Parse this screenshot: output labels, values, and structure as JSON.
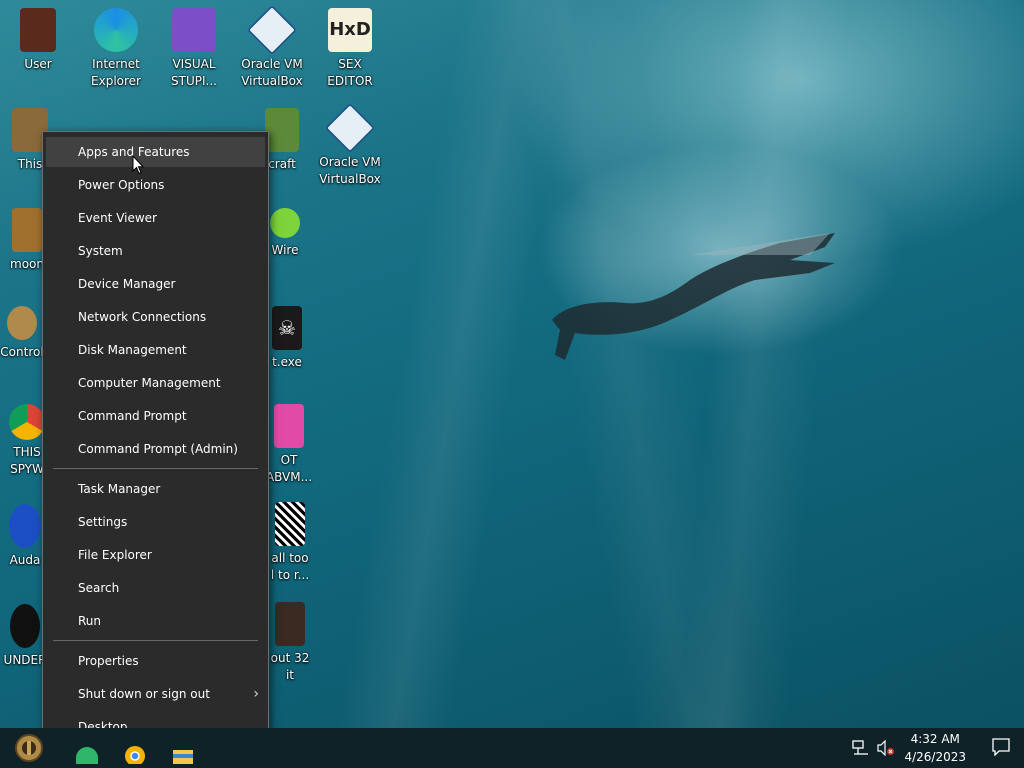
{
  "desktop": {
    "icons": [
      {
        "label": "User",
        "icon": "user-folder-icon"
      },
      {
        "label": "Internet\nExplorer",
        "icon": "edge-icon"
      },
      {
        "label": "VISUAL\nSTUPI...",
        "icon": "visual-studio-icon"
      },
      {
        "label": "Oracle VM\nVirtualBox",
        "icon": "virtualbox-icon"
      },
      {
        "label": "SEX\nEDITOR",
        "icon": "hxd-icon"
      },
      {
        "label": "This",
        "icon": "this-pc-icon"
      },
      {
        "label": "craft",
        "icon": "minecraft-icon"
      },
      {
        "label": "Oracle VM\nVirtualBox",
        "icon": "virtualbox-icon"
      },
      {
        "label": "moon",
        "icon": "moon-icon"
      },
      {
        "label": "Wire",
        "icon": "limewire-icon"
      },
      {
        "label": "Control",
        "icon": "control-panel-icon"
      },
      {
        "label": "t.exe",
        "icon": "skull-icon"
      },
      {
        "label": "THIS\nSPYW",
        "icon": "chrome-icon"
      },
      {
        "label": "OT\nABVM...",
        "icon": "app-icon"
      },
      {
        "label": "Auda",
        "icon": "audacity-icon"
      },
      {
        "label": "all too\nl to r...",
        "icon": "image-icon"
      },
      {
        "label": "UNDER",
        "icon": "undertale-icon"
      },
      {
        "label": "out 32\nit",
        "icon": "photo-icon"
      }
    ]
  },
  "context_menu": {
    "items": [
      "Apps and Features",
      "Power Options",
      "Event Viewer",
      "System",
      "Device Manager",
      "Network Connections",
      "Disk Management",
      "Computer Management",
      "Command Prompt",
      "Command Prompt (Admin)",
      "Task Manager",
      "Settings",
      "File Explorer",
      "Search",
      "Run",
      "Properties",
      "Shut down or sign out",
      "Desktop"
    ],
    "highlighted": "Apps and Features",
    "submenu_chevron": "›"
  },
  "taskbar": {
    "start_icon": "steampunk-start-icon",
    "pinned": [
      "android-app-icon",
      "chrome-icon",
      "folder-icon"
    ],
    "tray": {
      "network_icon": "network-icon",
      "volume_icon": "volume-muted-icon",
      "time": "4:32 AM",
      "date": "4/26/2023",
      "notifications_icon": "notification-icon"
    }
  }
}
